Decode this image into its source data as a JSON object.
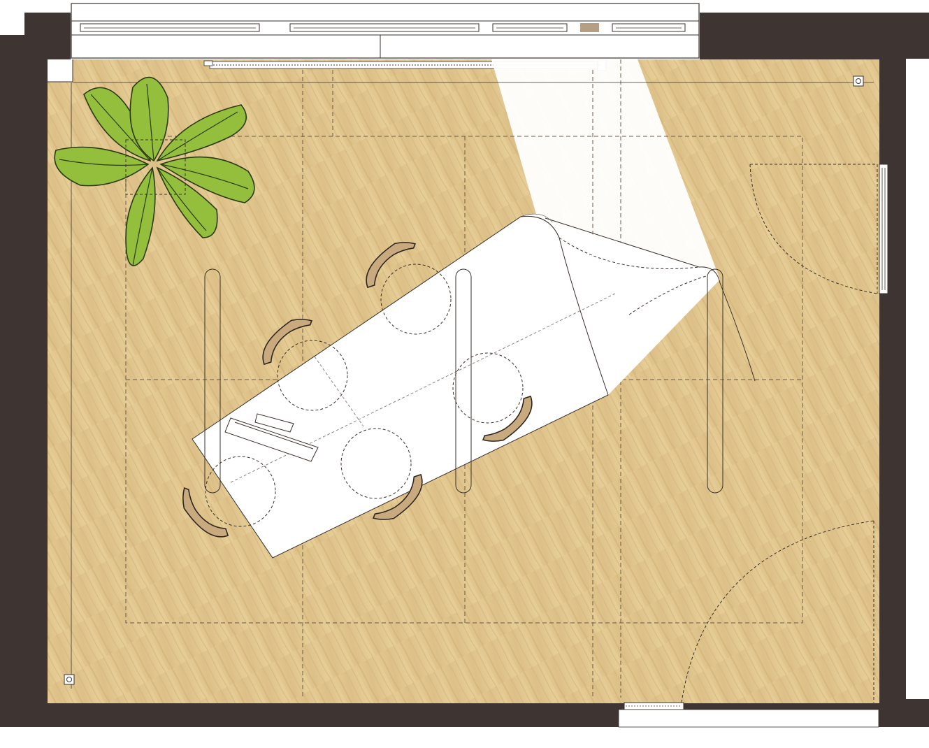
{
  "colors": {
    "wall": "#3e3532",
    "floor": "#e2c88f",
    "floor_grain": "#c9a86a",
    "plant": "#93bf3d",
    "line": "#3a302c",
    "window_beige": "#b59f84"
  },
  "icons": [
    "outlet-icon",
    "plant-icon",
    "chair-icon",
    "laptop-icon",
    "lamp-icon"
  ]
}
